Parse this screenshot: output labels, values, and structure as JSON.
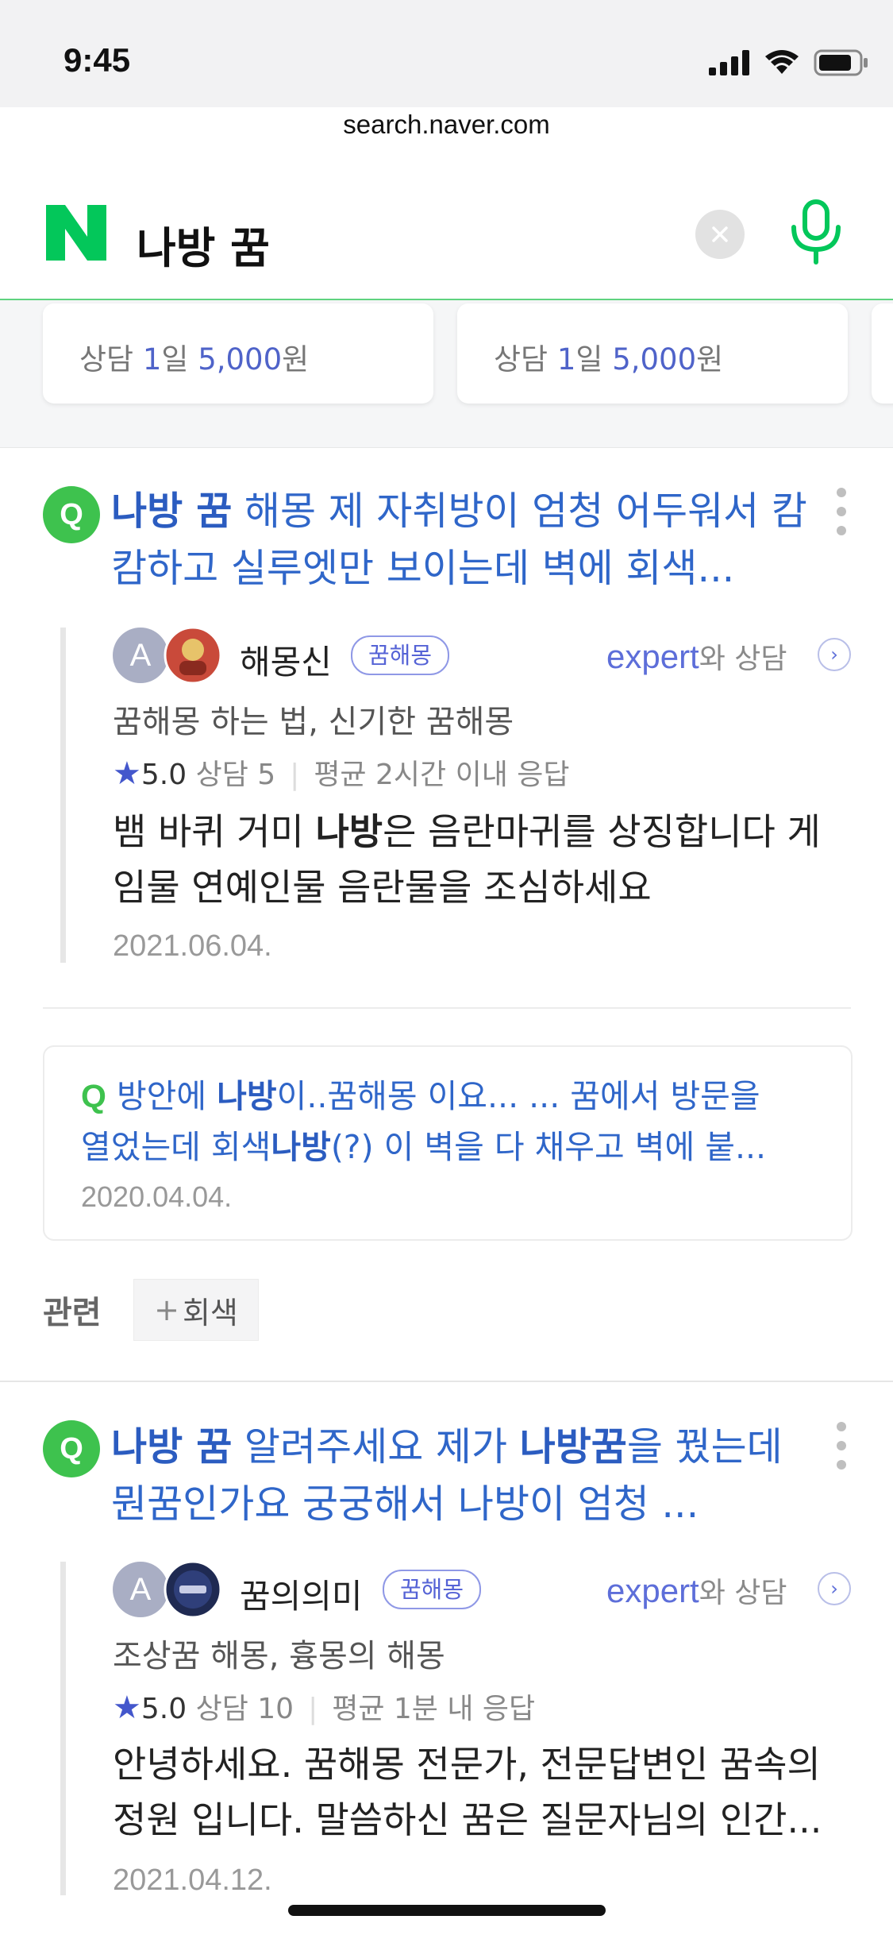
{
  "status": {
    "time": "9:45",
    "url": "search.naver.com"
  },
  "search": {
    "query": "나방 꿈"
  },
  "cards": [
    {
      "prefix": "상담 ",
      "num1": "1",
      "mid": "일 ",
      "num2": "5,000",
      "suffix": "원"
    },
    {
      "prefix": "상담 ",
      "num1": "1",
      "mid": "일 ",
      "num2": "5,000",
      "suffix": "원"
    }
  ],
  "results": [
    {
      "title_bold": "나방 꿈",
      "title_rest": " 해몽 제 자취방이 엄청 어두워서 캄캄하고 실루엣만 보이는데 벽에 회색...",
      "author": "해몽신",
      "tag": "꿈해몽",
      "expert_label": "expert",
      "expert_sub": "와 상담",
      "desc": "꿈해몽 하는 법, 신기한 꿈해몽",
      "score": "5.0",
      "consult": "상담 5",
      "response": "평균 2시간 이내 응답",
      "body_pre": "뱀 바퀴 거미 ",
      "body_bold": "나방",
      "body_post": "은 음란마귀를 상징합니다 게임물 연예인물 음란물을 조심하세요",
      "date": "2021.06.04."
    },
    {
      "title_bold": "나방 꿈",
      "title_mid": " 알려주세요 제가 ",
      "title_bold2": "나방꿈",
      "title_rest": "을 꿨는데 뭔꿈인가요 궁궁해서 나방이 엄청 ...",
      "author": "꿈의의미",
      "tag": "꿈해몽",
      "expert_label": "expert",
      "expert_sub": "와 상담",
      "desc": "조상꿈 해몽, 흉몽의 해몽",
      "score": "5.0",
      "consult": "상담 10",
      "response": "평균 1분 내 응답",
      "body": "안녕하세요. 꿈해몽 전문가, 전문답변인 꿈속의 정원 입니다. 말씀하신 꿈은 질문자님의 인간...",
      "date": "2021.04.12."
    }
  ],
  "box": {
    "q": "Q",
    "l1_pre": " 방안에 ",
    "l1_bold": "나방",
    "l1_post": "이..꿈해몽 이요... ... 꿈에서 방문을",
    "l2_pre": "열었는데 회색",
    "l2_bold": "나방",
    "l2_post": "(?) 이 벽을 다 채우고 벽에 붙...",
    "date": "2020.04.04."
  },
  "related": {
    "label": "관련",
    "chip": "회색",
    "plus": "+"
  },
  "badge": "Q",
  "avatar_letter": "A",
  "colors": {
    "naver_green": "#03c75a",
    "link_blue": "#2f66c9",
    "accent": "#5d6ed9"
  },
  "icons": [
    "signal-icon",
    "wifi-icon",
    "battery-icon",
    "naver-logo",
    "clear-icon",
    "mic-icon",
    "more-icon",
    "arrow-right-icon",
    "star-icon"
  ]
}
